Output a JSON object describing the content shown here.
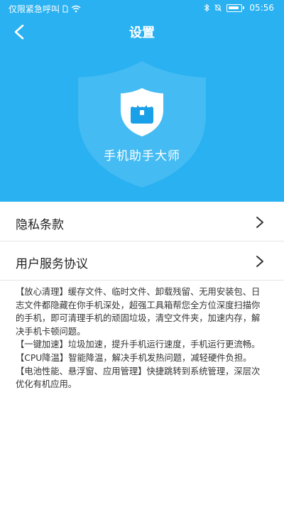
{
  "status_bar": {
    "carrier": "仅限紧急呼叫",
    "time": "05:56"
  },
  "nav": {
    "title": "设置"
  },
  "app": {
    "name": "手机助手大师"
  },
  "menu": {
    "items": [
      {
        "label": "隐私条款"
      },
      {
        "label": "用户服务协议"
      }
    ]
  },
  "description": {
    "paragraphs": [
      "【放心清理】缓存文件、临时文件、卸载残留、无用安装包、日志文件都隐藏在你手机深处，超强工具箱帮您全方位深度扫描你的手机，即可清理手机的顽固垃圾，清空文件夹，加速内存，解决手机卡顿问题。",
      "【一键加速】垃圾加速，提升手机运行速度，手机运行更流畅。",
      "【CPU降温】智能降温，解决手机发热问题，减轻硬件负担。",
      "【电池性能、悬浮窗、应用管理】快捷跳转到系统管理，深层次优化有机应用。"
    ]
  },
  "colors": {
    "accent": "#29b1f1",
    "logo_blue": "#1aa0e8"
  },
  "icons": {
    "back": "back-arrow-icon",
    "menu_arrow": "chevron-right-icon",
    "logo": "shield-briefcase-icon"
  }
}
